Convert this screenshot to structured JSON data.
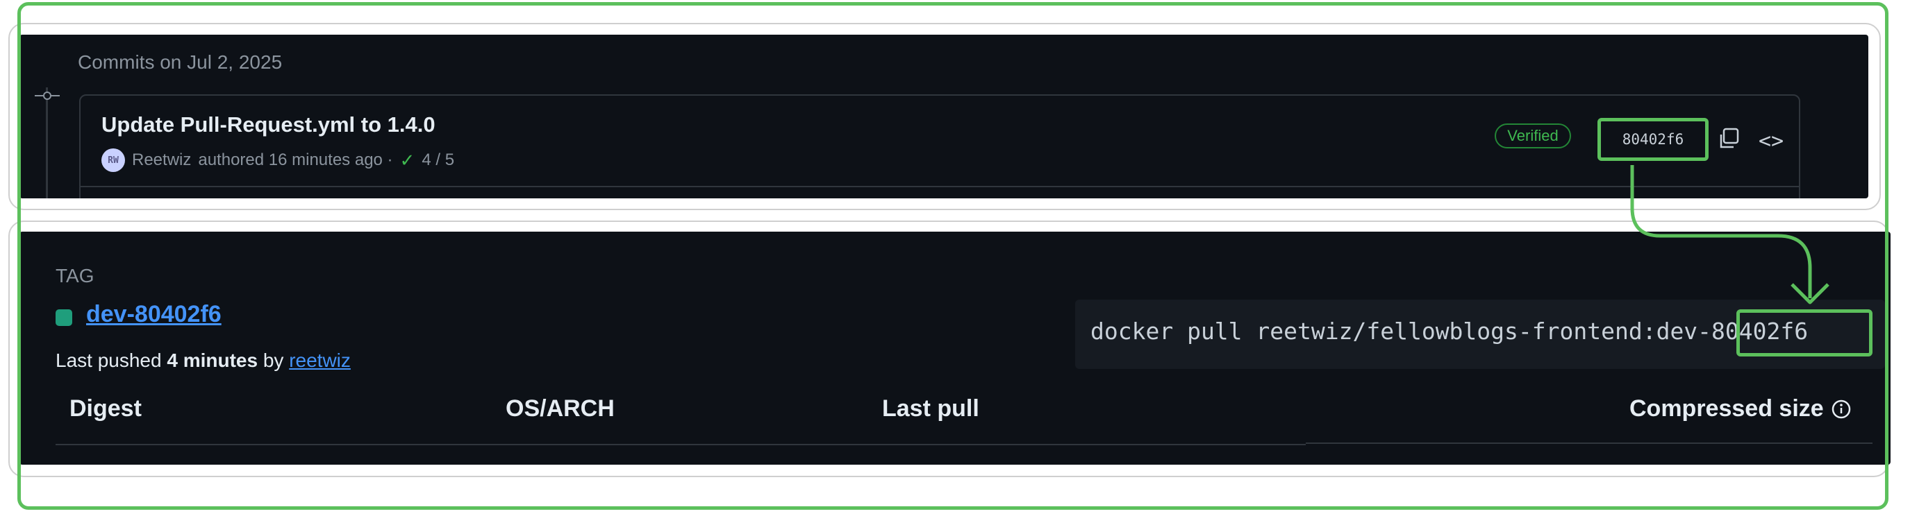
{
  "colors": {
    "highlight": "#5cc05c",
    "panel_bg": "#0d1117",
    "link": "#4493f8",
    "verified": "#3fb950"
  },
  "commits": {
    "heading": "Commits on Jul 2, 2025",
    "commit": {
      "title": "Update Pull-Request.yml to 1.4.0",
      "author": "Reetwiz",
      "authored_text": "authored 16 minutes ago ·",
      "checks": "4 / 5",
      "verified_label": "Verified",
      "sha": "80402f6",
      "avatar_initials": "RW"
    },
    "icons": [
      "commit-node-icon",
      "copy-icon",
      "code-icon",
      "check-icon"
    ]
  },
  "tag": {
    "label": "TAG",
    "name": "dev-80402f6",
    "last_pushed_prefix": "Last pushed",
    "last_pushed_time": "4 minutes",
    "by": "by",
    "pusher": "reetwiz",
    "pull_command": "docker pull reetwiz/fellowblogs-frontend:dev-80402f6",
    "table_headers": {
      "digest": "Digest",
      "os_arch": "OS/ARCH",
      "last_pull": "Last pull",
      "compressed_size": "Compressed size"
    }
  }
}
